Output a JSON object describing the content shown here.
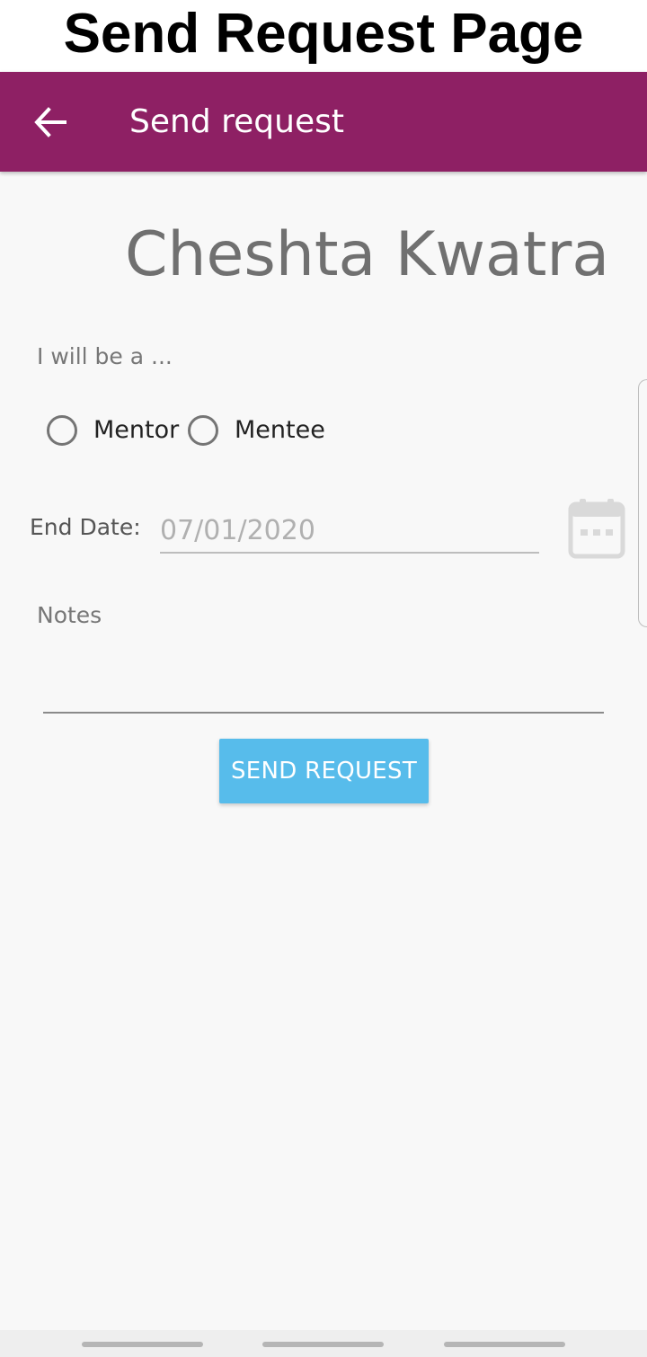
{
  "caption": "Send Request Page",
  "appbar": {
    "title": "Send request",
    "back_icon": "arrow-left-icon",
    "color": "#8e2064"
  },
  "profile": {
    "name": "Cheshta Kwatra"
  },
  "role": {
    "prompt": "I will be a ...",
    "options": [
      "Mentor",
      "Mentee"
    ],
    "selected": null
  },
  "end_date": {
    "label": "End Date:",
    "placeholder": "07/01/2020",
    "icon": "calendar-icon"
  },
  "notes": {
    "label": "Notes",
    "value": ""
  },
  "send_button": {
    "label": "SEND REQUEST",
    "color": "#57bceb"
  }
}
